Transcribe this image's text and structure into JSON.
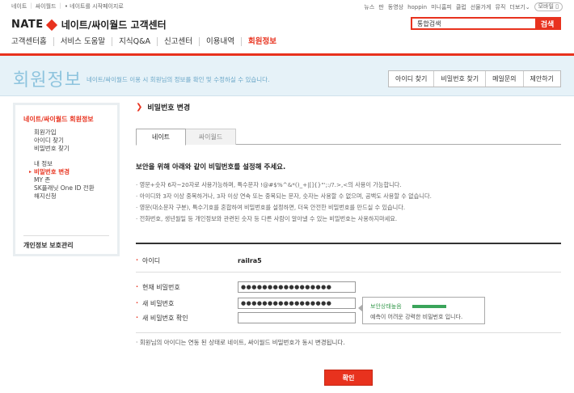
{
  "topbar": {
    "left_links": [
      "네이트",
      "싸이월드",
      "• 네이트를 시작페이지로"
    ],
    "right_links": [
      "뉴스",
      "판",
      "동영상",
      "hoppin",
      "미니홈피",
      "클럽",
      "선물가게",
      "뮤직",
      "더보기"
    ],
    "more_arrow": "⌄",
    "mobile": "모바일 ▯"
  },
  "logo": {
    "brand": "NATE",
    "title": "네이트/싸이월드 고객센터"
  },
  "search": {
    "placeholder": "통합검색",
    "value": "통합검색",
    "button": "검색"
  },
  "gnb": [
    "고객센터홈",
    "서비스 도움말",
    "지식Q&A",
    "신고센터",
    "이용내역",
    "회원정보"
  ],
  "banner": {
    "title": "회원정보",
    "desc": "네이트/싸이월드 이용 시 회원님의 정보를 확인 및 수정하실 수 있습니다.",
    "buttons": [
      "아이디 찾기",
      "비밀번호 찾기",
      "메일문의",
      "제안하기"
    ]
  },
  "lnb": {
    "heading": "네이트/싸이월드 회원정보",
    "group1": [
      "회원가입",
      "아이디 찾기",
      "비밀번호 찾기"
    ],
    "group2": [
      "내 정보",
      "비밀번호 변경",
      "MY 존",
      "SK플래닛 One ID 전환",
      "해지신청"
    ],
    "privacy": "개인정보 보호관리"
  },
  "main": {
    "title_arrow": "❯",
    "title": "비밀번호 변경",
    "tabs": [
      "네이트",
      "싸이월드"
    ],
    "lead": "보안을 위해 아래와 같이 비밀번호를 설정해 주세요.",
    "rules": [
      "영문+숫자 6자~20자로 사용가능하며, 특수문자 !@#$%^&*()_+|[]{}\"';:/?.>,<의 사용이 가능합니다.",
      "아이디와 3자 이상 중복하거나, 3자 이상 연속 또는 중복되는 문자, 숫자는 사용할 수 없으며, 공백도 사용할 수 없습니다.",
      "영문(대소문자 구분), 특수기호를 혼합하여 비밀번호를 설정하면, 더욱 안전한 비밀번호를 만드실 수 있습니다.",
      "전화번호, 생년월일 등 개인정보와 관련된 숫자 등 다른 사람이 알아낼 수 있는 비밀번호는 사용하지마세요."
    ],
    "id_label": "아이디",
    "id_value": "railra5",
    "current_pw_label": "현재 비밀번호",
    "current_pw_value": "●●●●●●●●●●●●●●●●●",
    "new_pw_label": "새 비밀번호",
    "new_pw_value": "●●●●●●●●●●●●●●●●●",
    "confirm_pw_label": "새 비밀번호 확인",
    "confirm_pw_value": "",
    "tip_status": "보안상태높음",
    "tip_desc": "예측이 어려운 강력한 비밀번호 입니다.",
    "note": "회원님의 아이디는 연동 된 상태로 네이트, 싸이월드 비밀번호가 동시 변경됩니다.",
    "confirm_button": "확인"
  },
  "colors": {
    "accent": "#e8321e",
    "banner_bg": "#e6f2f8",
    "banner_text": "#8ec4de",
    "strength": "#3aa45a"
  }
}
